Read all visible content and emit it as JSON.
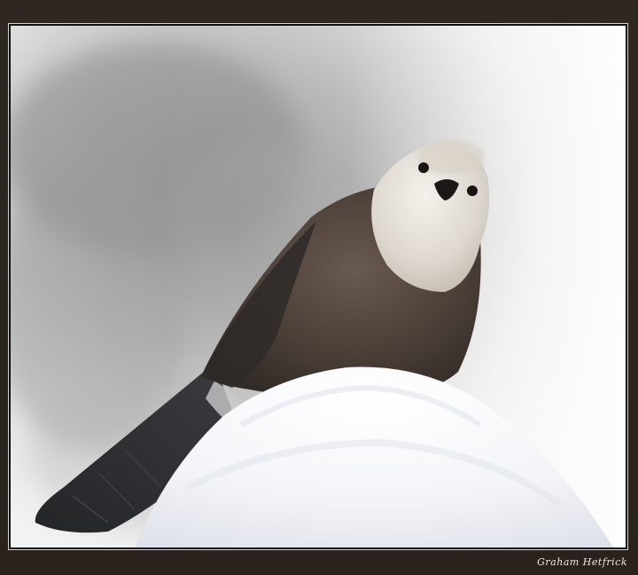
{
  "image": {
    "subject": "gray-jay-bird",
    "scene": "bird-perched-on-snow-mound",
    "signature_text": "Graham Hetfrick",
    "colors": {
      "frame": "#2d2620",
      "frame_border": "#d8d2c8",
      "background_light": "#eeeeee",
      "background_dark": "#9a9a9a",
      "bird_body": "#4a3d35",
      "bird_head": "#e6e1d9",
      "snow": "#f6f7fa"
    }
  }
}
